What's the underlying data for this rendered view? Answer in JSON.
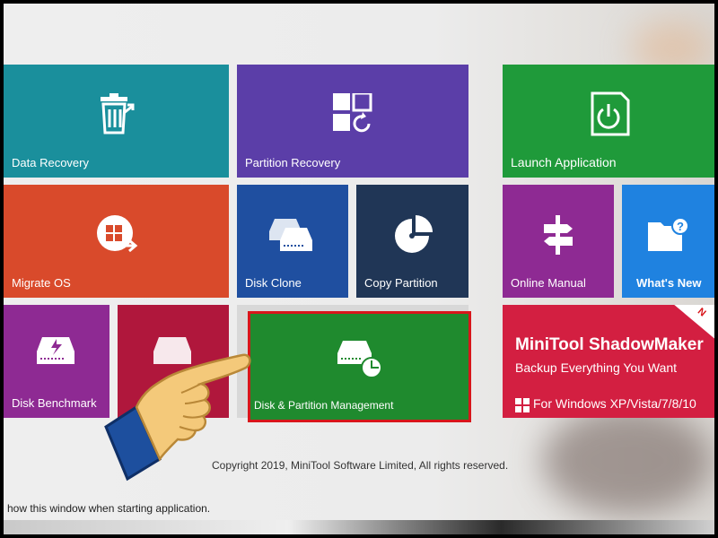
{
  "tiles": {
    "data_recovery": "Data Recovery",
    "partition_recovery": "Partition Recovery",
    "launch_application": "Launch Application",
    "migrate_os": "Migrate OS",
    "disk_clone": "Disk Clone",
    "copy_partition": "Copy Partition",
    "online_manual": "Online Manual",
    "whats_new": "What's New",
    "disk_benchmark": "Disk Benchmark",
    "disk_partition_management": "Disk & Partition Management"
  },
  "shadowmaker": {
    "title": "MiniTool ShadowMaker",
    "subtitle": "Backup Everything You Want",
    "platforms": "For Windows XP/Vista/7/8/10",
    "badge": "N"
  },
  "footer": {
    "copyright": "Copyright 2019, MiniTool Software Limited, All rights reserved.",
    "show_window": "how this window when starting application."
  },
  "colors": {
    "teal": "#1a8f9c",
    "purple": "#5b3ea8",
    "green": "#1f9a3a",
    "orange": "#d94a2b",
    "navy": "#1f4fa0",
    "darknavy": "#203656",
    "magenta": "#8e2a93",
    "blue": "#1f82e0",
    "crimson": "#b0173c",
    "red": "#d31f41",
    "selection": "#d8161b"
  },
  "icons": [
    "trash-recover-icon",
    "partition-grid-icon",
    "power-icon",
    "migrate-os-icon",
    "disk-clone-icon",
    "pie-chart-icon",
    "signpost-icon",
    "folder-question-icon",
    "disk-benchmark-icon",
    "disk-manage-icon",
    "windows-logo-icon",
    "pointing-hand-icon"
  ]
}
